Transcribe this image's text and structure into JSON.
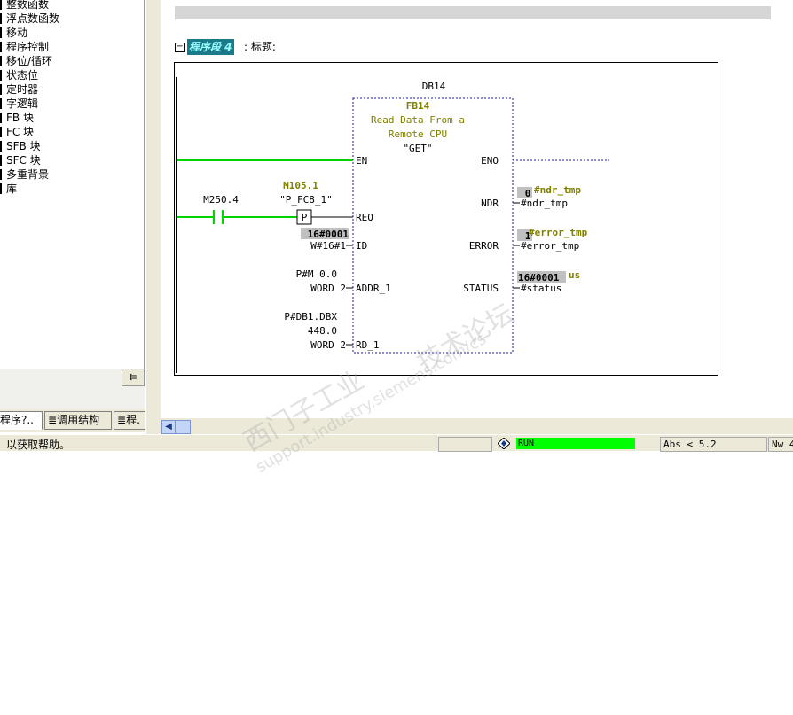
{
  "left_tree": {
    "items": [
      {
        "label": "整数函数"
      },
      {
        "label": "浮点数函数"
      },
      {
        "label": "移动"
      },
      {
        "label": "程序控制"
      },
      {
        "label": "移位/循环"
      },
      {
        "label": "状态位"
      },
      {
        "label": "定时器"
      },
      {
        "label": "字逻辑"
      },
      {
        "label": "FB 块"
      },
      {
        "label": "FC 块"
      },
      {
        "label": "SFB 块"
      },
      {
        "label": "SFC 块"
      },
      {
        "label": "多重背景"
      },
      {
        "label": "库"
      }
    ],
    "collapse_glyph": "⇇"
  },
  "left_tabs": [
    {
      "label": "程序?.."
    },
    {
      "label": "调用结构"
    },
    {
      "label": "程."
    }
  ],
  "network": {
    "label": "程序段 4",
    "title": ": 标题:"
  },
  "block": {
    "instance_db": "DB14",
    "fb": "FB14",
    "desc_line1": "Read Data From a",
    "desc_line2": "Remote CPU",
    "name": "\"GET\"",
    "en": "EN",
    "eno": "ENO",
    "req": "REQ",
    "id": "ID",
    "addr": "ADDR_1",
    "rd": "RD_1",
    "ndr": "NDR",
    "error": "ERROR",
    "status": "STATUS"
  },
  "inputs": {
    "contact_addr": "M250.4",
    "edge_addr": "M105.1",
    "edge_symbol": "\"P_FC8_1\"",
    "edge_glyph": "P",
    "id_value": "16#0001",
    "id_param": "W#16#1",
    "addr_line1": "P#M 0.0",
    "addr_line2": "WORD 2",
    "rd_line1": "P#DB1.DBX",
    "rd_line2": "448.0",
    "rd_line3": "WORD 2"
  },
  "outputs": {
    "ndr_value": "0",
    "ndr_symbol": "#ndr_tmp",
    "ndr_param": "#ndr_tmp",
    "error_value": "1",
    "error_symbol": "#error_tmp",
    "error_param": "#error_tmp",
    "status_value": "16#0001",
    "status_symbol": "us",
    "status_param": "#status"
  },
  "statusbar": {
    "help": "以获取帮助。",
    "run": "RUN",
    "abs": "Abs < 5.2",
    "nw": "Nw 4"
  },
  "watermark": {
    "line1": "西门子工业",
    "line2": "support.industry.siemens.com/cs",
    "line3": "技术论坛"
  },
  "colors": {
    "power_flow": "#00d400",
    "status_value_bg": "#c0c0c0",
    "symbol_text": "#808000",
    "run_bg": "#00ff00"
  }
}
